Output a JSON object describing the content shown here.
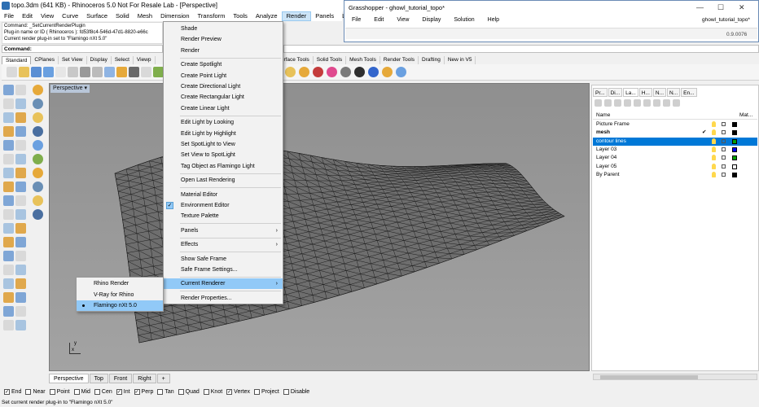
{
  "window": {
    "title": "topo.3dm (641 KB) - Rhinoceros 5.0 Not For Resale Lab - [Perspective]"
  },
  "menubar": {
    "items": [
      "File",
      "Edit",
      "View",
      "Curve",
      "Surface",
      "Solid",
      "Mesh",
      "Dimension",
      "Transform",
      "Tools",
      "Analyze",
      "Render",
      "Panels",
      "Lands Design"
    ],
    "active": "Render"
  },
  "command": {
    "history": [
      "Command: _SetCurrentRenderPlugin",
      "Plug-in name or ID ( Rhinoceros ): fd53f8c4-546d-47d1-8820-e66c",
      "Current render plug-in set to \"Flamingo nXt 5.0\""
    ],
    "prompt": "Command:"
  },
  "toolbar_tabs": {
    "left": [
      "Standard",
      "CPlanes",
      "Set View",
      "Display",
      "Select",
      "Viewp"
    ],
    "right": [
      "Surface Tools",
      "Solid Tools",
      "Mesh Tools",
      "Render Tools",
      "Drafting",
      "New in V5"
    ],
    "selected": "Standard"
  },
  "viewport": {
    "title": "Perspective",
    "tabs": [
      "Perspective",
      "Top",
      "Front",
      "Right",
      "+"
    ],
    "selected_tab": "Perspective",
    "axis_x": "x",
    "axis_y": "y"
  },
  "render_menu": {
    "items": [
      {
        "label": "Shade"
      },
      {
        "label": "Render Preview"
      },
      {
        "label": "Render"
      },
      {
        "sep": true
      },
      {
        "label": "Create Spotlight"
      },
      {
        "label": "Create Point Light"
      },
      {
        "label": "Create Directional Light"
      },
      {
        "label": "Create Rectangular Light"
      },
      {
        "label": "Create Linear Light"
      },
      {
        "sep": true
      },
      {
        "label": "Edit Light by Looking"
      },
      {
        "label": "Edit Light by Highlight"
      },
      {
        "label": "Set SpotLight to View"
      },
      {
        "label": "Set View to SpotLight"
      },
      {
        "label": "Tag Object as Flamingo Light"
      },
      {
        "sep": true
      },
      {
        "label": "Open Last Rendering"
      },
      {
        "sep": true
      },
      {
        "label": "Material Editor"
      },
      {
        "label": "Environment Editor",
        "checked": true
      },
      {
        "label": "Texture Palette"
      },
      {
        "sep": true
      },
      {
        "label": "Panels",
        "submenu": true
      },
      {
        "sep": true
      },
      {
        "label": "Effects",
        "submenu": true
      },
      {
        "sep": true
      },
      {
        "label": "Show Safe Frame"
      },
      {
        "label": "Safe Frame Settings..."
      },
      {
        "sep": true
      },
      {
        "label": "Current Renderer",
        "submenu": true,
        "highlighted": true
      },
      {
        "sep": true
      },
      {
        "label": "Render Properties..."
      }
    ]
  },
  "renderer_submenu": {
    "items": [
      {
        "label": "Rhino Render"
      },
      {
        "label": "V-Ray for Rhino"
      },
      {
        "label": "Flamingo nXt 5.0",
        "selected": true
      }
    ]
  },
  "right_panel": {
    "tabs": [
      "Pr...",
      "Di...",
      "La...",
      "H...",
      "N...",
      "N...",
      "En..."
    ],
    "selected_tab": "La...",
    "columns": {
      "name": "Name",
      "material": "Mat..."
    },
    "layers": [
      {
        "name": "Picture Frame",
        "color": "#000000"
      },
      {
        "name": "mesh",
        "color": "#000000",
        "current": true
      },
      {
        "name": "contour lines",
        "color": "#00a000",
        "selected": true
      },
      {
        "name": "Layer 03",
        "color": "#0000ff"
      },
      {
        "name": "Layer 04",
        "color": "#00a000"
      },
      {
        "name": "Layer 05",
        "color": "#ffffff"
      },
      {
        "name": "By Parent",
        "color": "#000000"
      }
    ]
  },
  "osnap": [
    {
      "label": "End",
      "checked": true
    },
    {
      "label": "Near",
      "checked": false
    },
    {
      "label": "Point",
      "checked": false
    },
    {
      "label": "Mid",
      "checked": false
    },
    {
      "label": "Cen",
      "checked": false
    },
    {
      "label": "Int",
      "checked": true
    },
    {
      "label": "Perp",
      "checked": true
    },
    {
      "label": "Tan",
      "checked": false
    },
    {
      "label": "Quad",
      "checked": false
    },
    {
      "label": "Knot",
      "checked": false
    },
    {
      "label": "Vertex",
      "checked": true
    },
    {
      "label": "Project",
      "checked": false
    },
    {
      "label": "Disable",
      "checked": false
    }
  ],
  "status": "Set current render plug-in to \"Flamingo nXt 5.0\"",
  "grasshopper": {
    "title": "Grasshopper - ghowl_tutorial_topo*",
    "menus": [
      "File",
      "Edit",
      "View",
      "Display",
      "Solution",
      "Help"
    ],
    "file_tab": "ghowl_tutorial_topo*",
    "zoom": "0.9.0076"
  },
  "colors": {
    "accent": "#0078d7",
    "menu_highlight": "#91c9f7",
    "viewport_bg": "#999999"
  }
}
